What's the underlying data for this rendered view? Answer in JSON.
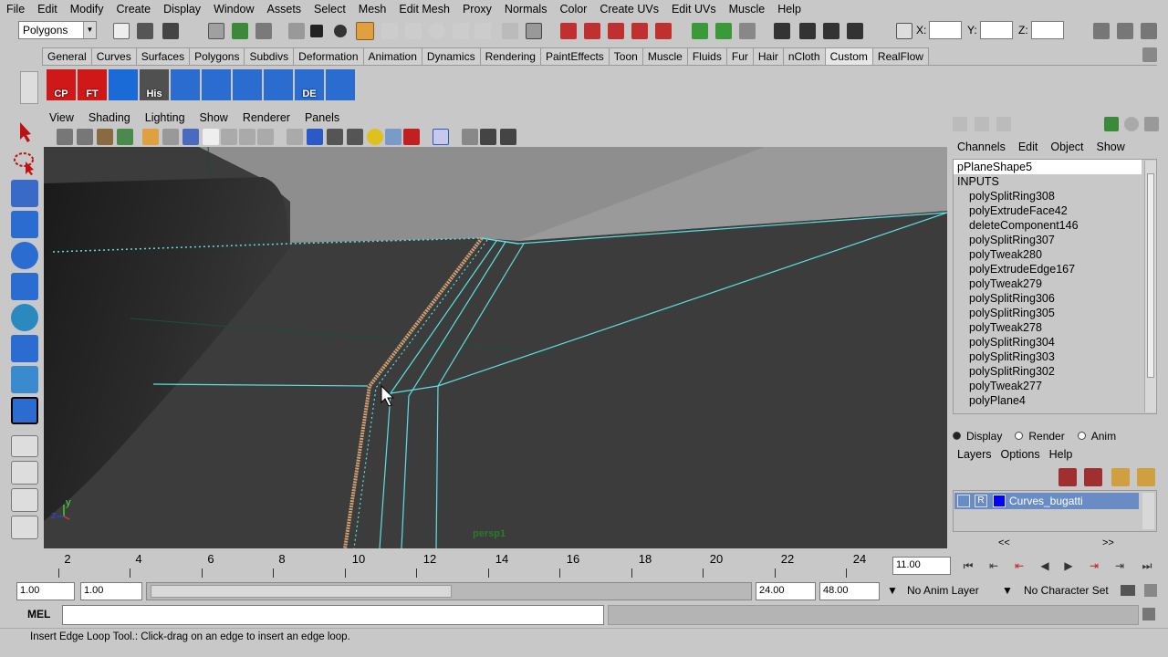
{
  "menubar": [
    "File",
    "Edit",
    "Modify",
    "Create",
    "Display",
    "Window",
    "Assets",
    "Select",
    "Mesh",
    "Edit Mesh",
    "Proxy",
    "Normals",
    "Color",
    "Create UVs",
    "Edit UVs",
    "Muscle",
    "Help"
  ],
  "status_line": {
    "mode": "Polygons",
    "x_label": "X:",
    "y_label": "Y:",
    "z_label": "Z:",
    "x_value": "",
    "y_value": "",
    "z_value": ""
  },
  "shelf_tabs": [
    "General",
    "Curves",
    "Surfaces",
    "Polygons",
    "Subdivs",
    "Deformation",
    "Animation",
    "Dynamics",
    "Rendering",
    "PaintEffects",
    "Toon",
    "Muscle",
    "Fluids",
    "Fur",
    "Hair",
    "nCloth",
    "Custom",
    "RealFlow"
  ],
  "active_shelf": "Custom",
  "shelf_buttons": [
    {
      "label": "CP",
      "color": "#d01818"
    },
    {
      "label": "FT",
      "color": "#d01818"
    },
    {
      "label": "",
      "color": "#1a6ad8"
    },
    {
      "label": "His",
      "color": "#404040"
    },
    {
      "label": "",
      "color": "#2a6cd0"
    },
    {
      "label": "",
      "color": "#2a6cd0"
    },
    {
      "label": "",
      "color": "#2a6cd0"
    },
    {
      "label": "",
      "color": "#2a6cd0"
    },
    {
      "label": "DE",
      "color": "#2a6cd0"
    },
    {
      "label": "",
      "color": "#2a6cd0"
    }
  ],
  "panel_menu": [
    "View",
    "Shading",
    "Lighting",
    "Show",
    "Renderer",
    "Panels"
  ],
  "viewport": {
    "camera_label": "persp1",
    "axis_y": "y",
    "axis_z": "z"
  },
  "channel_box": {
    "menu": [
      "Channels",
      "Edit",
      "Object",
      "Show"
    ],
    "object_name": "pPlaneShape5",
    "inputs_header": "INPUTS",
    "inputs": [
      "polySplitRing308",
      "polyExtrudeFace42",
      "deleteComponent146",
      "polySplitRing307",
      "polyTweak280",
      "polyExtrudeEdge167",
      "polyTweak279",
      "polySplitRing306",
      "polySplitRing305",
      "polyTweak278",
      "polySplitRing304",
      "polySplitRing303",
      "polySplitRing302",
      "polyTweak277",
      "polyPlane4"
    ]
  },
  "layer_editor": {
    "radios": [
      "Display",
      "Render",
      "Anim"
    ],
    "selected_radio": "Display",
    "menu": [
      "Layers",
      "Options",
      "Help"
    ],
    "layer": {
      "visible": "",
      "render": "R",
      "color": "#0000ff",
      "name": "Curves_bugatti"
    },
    "nav_left": "<<",
    "nav_right": ">>"
  },
  "time_slider": {
    "ticks": [
      "2",
      "4",
      "6",
      "8",
      "10",
      "12",
      "14",
      "16",
      "18",
      "20",
      "22",
      "24"
    ],
    "current_time": "11.00"
  },
  "range_slider": {
    "start": "1.00",
    "playback_start": "1.00",
    "playback_end": "24.00",
    "end": "48.00",
    "anim_layer": "No Anim Layer",
    "character_set": "No Character Set"
  },
  "command_line": {
    "label": "MEL",
    "value": ""
  },
  "help_line": "Insert Edge Loop Tool.: Click-drag on an edge to insert an edge loop."
}
